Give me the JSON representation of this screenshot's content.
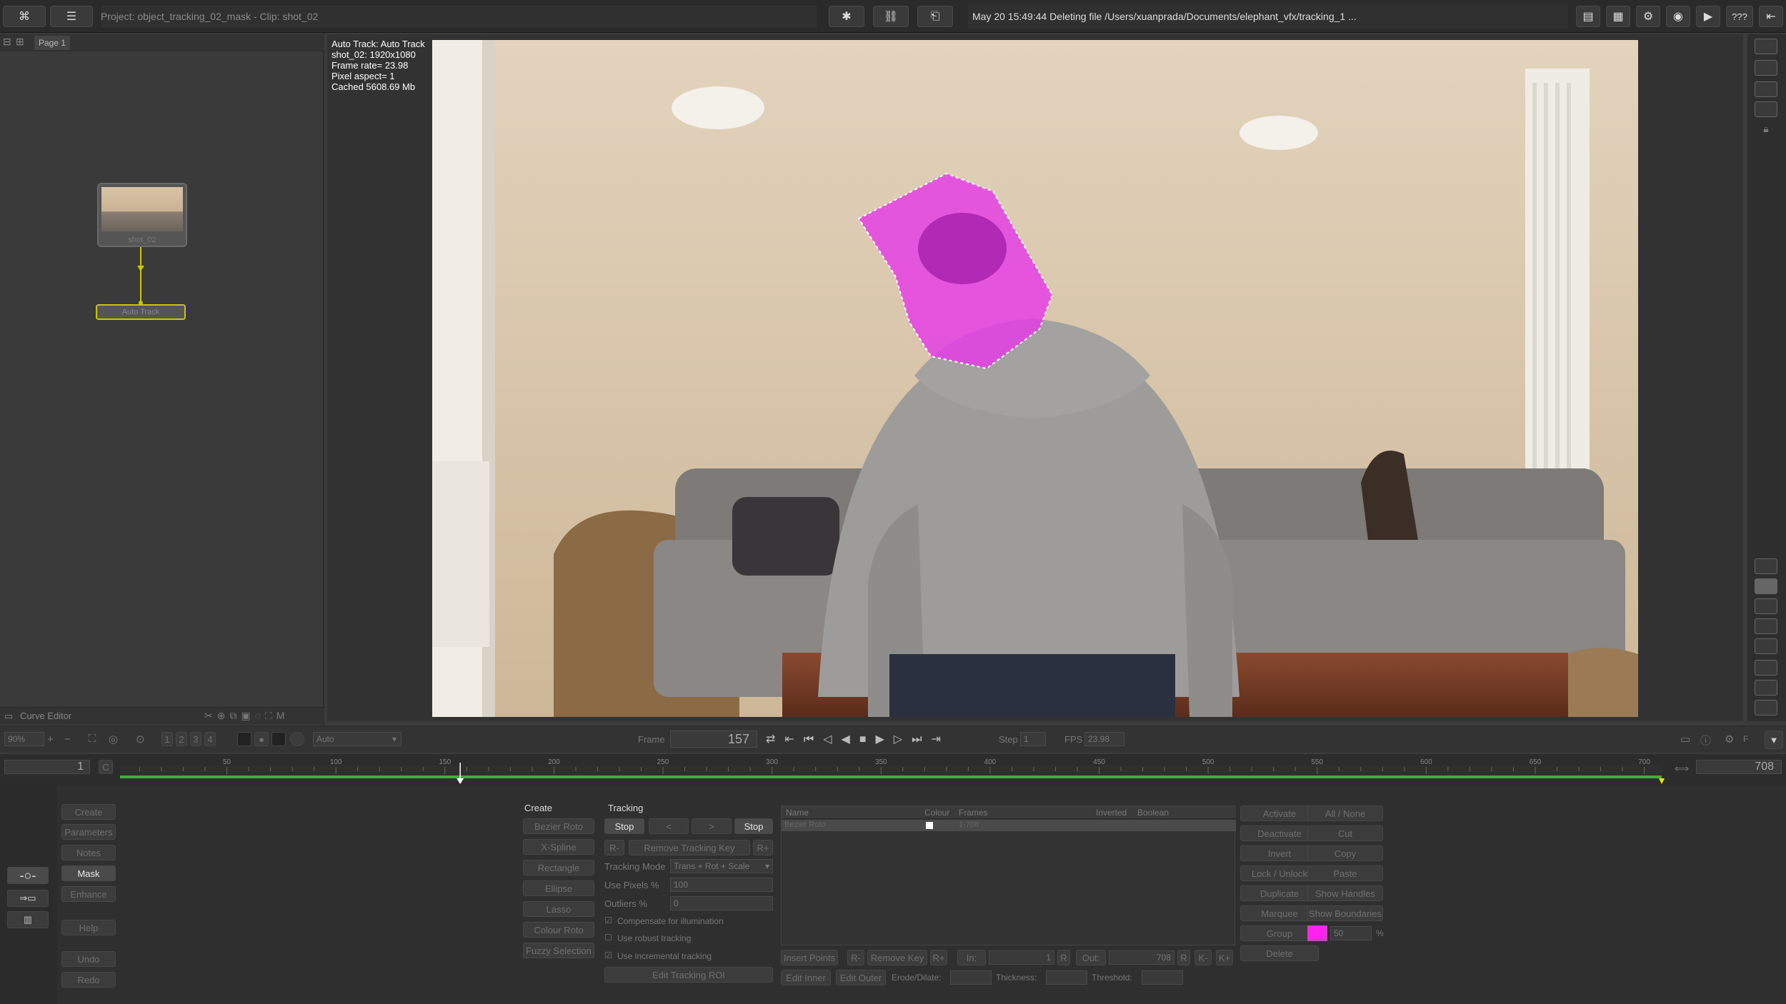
{
  "header": {
    "project_title": "Project: object_tracking_02_mask - Clip: shot_02",
    "status_message": "May 20 15:49:44 Deleting file /Users/xuanprada/Documents/elephant_vfx/tracking_1 ...",
    "help_label": "???"
  },
  "node_graph": {
    "page_tab": "Page 1",
    "source_node_label": "shot_02",
    "track_node_label": "Auto Track",
    "curve_editor_label": "Curve Editor"
  },
  "viewer_info": {
    "line1": "Auto Track: Auto Track",
    "line2": "shot_02: 1920x1080",
    "line3": "Frame rate= 23.98",
    "line4": "Pixel aspect= 1",
    "line5": "Cached 5608.69 Mb"
  },
  "transport": {
    "zoom": "90%",
    "channels": [
      "1",
      "2",
      "3",
      "4"
    ],
    "view_mode": "Auto",
    "frame_label": "Frame",
    "frame_value": "157",
    "step_label": "Step",
    "step_value": "1",
    "fps_label": "FPS",
    "fps_value": "23.98"
  },
  "timeline": {
    "start": "1",
    "end": "708",
    "current_frame": 157,
    "in_frame": 1,
    "out_frame": 708,
    "c_label": "C",
    "ticks": [
      "50",
      "100",
      "150",
      "200",
      "250",
      "300",
      "350",
      "400",
      "450",
      "500",
      "550",
      "600",
      "650",
      "700"
    ]
  },
  "tools_sidebar": {
    "buttons": [
      "Create",
      "Parameters",
      "Notes",
      "Mask",
      "Enhance",
      "Help",
      "Undo",
      "Redo"
    ]
  },
  "create_panel": {
    "title": "Create",
    "buttons": [
      "Bezier Roto",
      "X-Spline",
      "Rectangle",
      "Ellipse",
      "Lasso",
      "Colour Roto",
      "Fuzzy Selection"
    ]
  },
  "tracking_panel": {
    "title": "Tracking",
    "stop_left": "Stop",
    "prev": "<",
    "next": ">",
    "stop_right": "Stop",
    "r_minus": "R-",
    "remove_key": "Remove Tracking Key",
    "r_plus": "R+",
    "mode_label": "Tracking Mode",
    "mode_value": "Trans + Rot + Scale",
    "use_pixels_label": "Use Pixels %",
    "use_pixels_value": "100",
    "outliers_label": "Outliers %",
    "outliers_value": "0",
    "compensate": "Compensate for illumination",
    "robust": "Use robust tracking",
    "incremental": "Use incremental tracking",
    "edit_roi": "Edit Tracking ROI"
  },
  "layers_table": {
    "columns": [
      "Name",
      "Colour",
      "Frames",
      "Inverted",
      "Boolean"
    ],
    "row_name": "Bezier Roto",
    "row_frames": "1-708"
  },
  "points_bar": {
    "insert_points": "Insert Points",
    "r_minus": "R-",
    "remove_key": "Remove Key",
    "r_plus": "R+",
    "in_label": "In:",
    "in_value": "1",
    "r1": "R",
    "out_label": "Out:",
    "out_value": "708",
    "r2": "R",
    "k_minus": "K-",
    "k_plus": "K+",
    "edit_inner": "Edit Inner",
    "edit_outer": "Edit Outer",
    "erode_label": "Erode/Dilate:",
    "thickness_label": "Thickness:",
    "threshold_label": "Threshold:"
  },
  "actions_panel": {
    "left": [
      "Activate",
      "Deactivate",
      "Invert",
      "Lock / Unlock",
      "Duplicate",
      "Marquee",
      "Group",
      "Delete"
    ],
    "right": [
      "All / None",
      "Cut",
      "Copy",
      "Paste",
      "Show Handles",
      "Show Boundaries"
    ],
    "opacity_value": "50",
    "percent": "%",
    "mask_color": "#ff22ee"
  },
  "colors": {
    "mask_overlay": "#e53be6",
    "node_selected": "#c8c800",
    "timeline_green": "#3fae3f"
  }
}
